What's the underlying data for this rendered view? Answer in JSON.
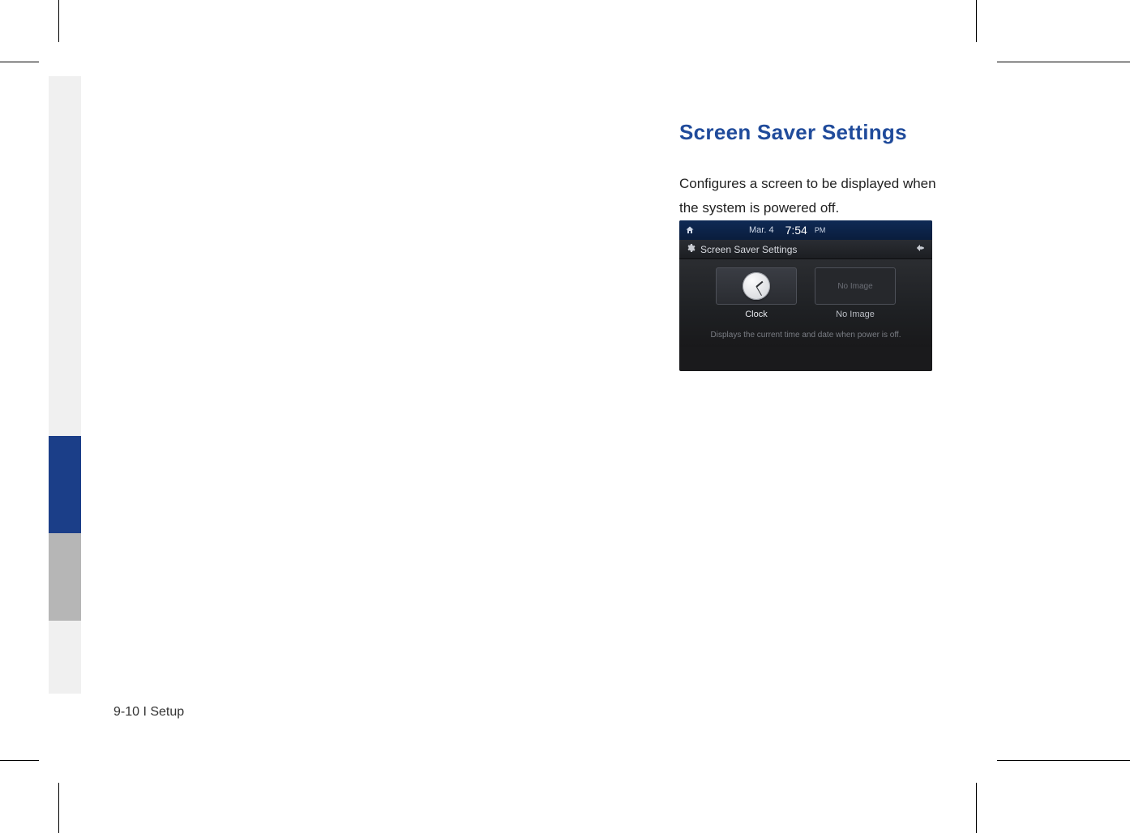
{
  "page": {
    "footer": "9-10 I Setup"
  },
  "section": {
    "heading": "Screen Saver Settings",
    "body_line1": "Configures a screen to be displayed when",
    "body_line2": "the system is powered off."
  },
  "device": {
    "statusbar": {
      "date": "Mar.  4",
      "time": "7:54",
      "time_suffix": "PM"
    },
    "titlebar": {
      "title": "Screen Saver Settings"
    },
    "options": {
      "clock_label": "Clock",
      "noimage_thumb_text": "No Image",
      "noimage_label": "No Image"
    },
    "hint": "Displays the current time and date when power is off."
  }
}
